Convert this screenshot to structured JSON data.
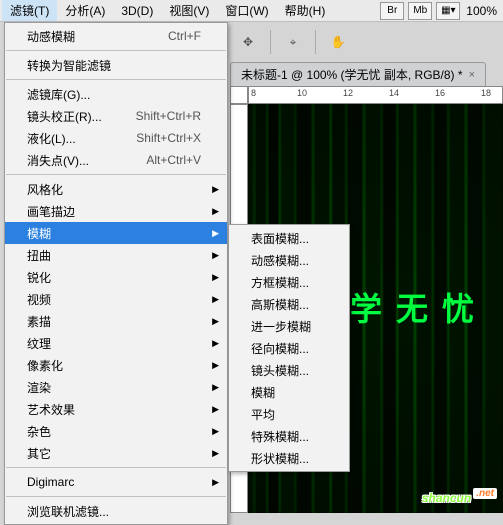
{
  "menubar": {
    "items": [
      "滤镜(T)",
      "分析(A)",
      "3D(D)",
      "视图(V)",
      "窗口(W)",
      "帮助(H)"
    ],
    "icon_br": "Br",
    "icon_mb": "Mb",
    "zoom": "100%"
  },
  "tab": {
    "title": "未标题-1 @ 100% (学无忧 副本, RGB/8) *",
    "close": "×"
  },
  "ruler_ticks": [
    "8",
    "10",
    "12",
    "14",
    "16",
    "18"
  ],
  "canvas_text": "学无忧",
  "watermark": {
    "brand": "shancun",
    "suffix": ".net"
  },
  "menu1": {
    "g1": [
      {
        "label": "动感模糊",
        "acc": "Ctrl+F"
      }
    ],
    "g2": [
      {
        "label": "转换为智能滤镜"
      }
    ],
    "g3": [
      {
        "label": "滤镜库(G)..."
      },
      {
        "label": "镜头校正(R)...",
        "acc": "Shift+Ctrl+R"
      },
      {
        "label": "液化(L)...",
        "acc": "Shift+Ctrl+X"
      },
      {
        "label": "消失点(V)...",
        "acc": "Alt+Ctrl+V"
      }
    ],
    "g4": [
      {
        "label": "风格化",
        "sub": true
      },
      {
        "label": "画笔描边",
        "sub": true
      },
      {
        "label": "模糊",
        "sub": true,
        "selected": true
      },
      {
        "label": "扭曲",
        "sub": true
      },
      {
        "label": "锐化",
        "sub": true
      },
      {
        "label": "视频",
        "sub": true
      },
      {
        "label": "素描",
        "sub": true
      },
      {
        "label": "纹理",
        "sub": true
      },
      {
        "label": "像素化",
        "sub": true
      },
      {
        "label": "渲染",
        "sub": true
      },
      {
        "label": "艺术效果",
        "sub": true
      },
      {
        "label": "杂色",
        "sub": true
      },
      {
        "label": "其它",
        "sub": true
      }
    ],
    "g5": [
      {
        "label": "Digimarc",
        "sub": true
      }
    ],
    "g6": [
      {
        "label": "浏览联机滤镜..."
      }
    ]
  },
  "menu2": {
    "items": [
      {
        "label": "表面模糊..."
      },
      {
        "label": "动感模糊..."
      },
      {
        "label": "方框模糊..."
      },
      {
        "label": "高斯模糊..."
      },
      {
        "label": "进一步模糊"
      },
      {
        "label": "径向模糊..."
      },
      {
        "label": "镜头模糊..."
      },
      {
        "label": "模糊"
      },
      {
        "label": "平均"
      },
      {
        "label": "特殊模糊..."
      },
      {
        "label": "形状模糊..."
      }
    ]
  }
}
